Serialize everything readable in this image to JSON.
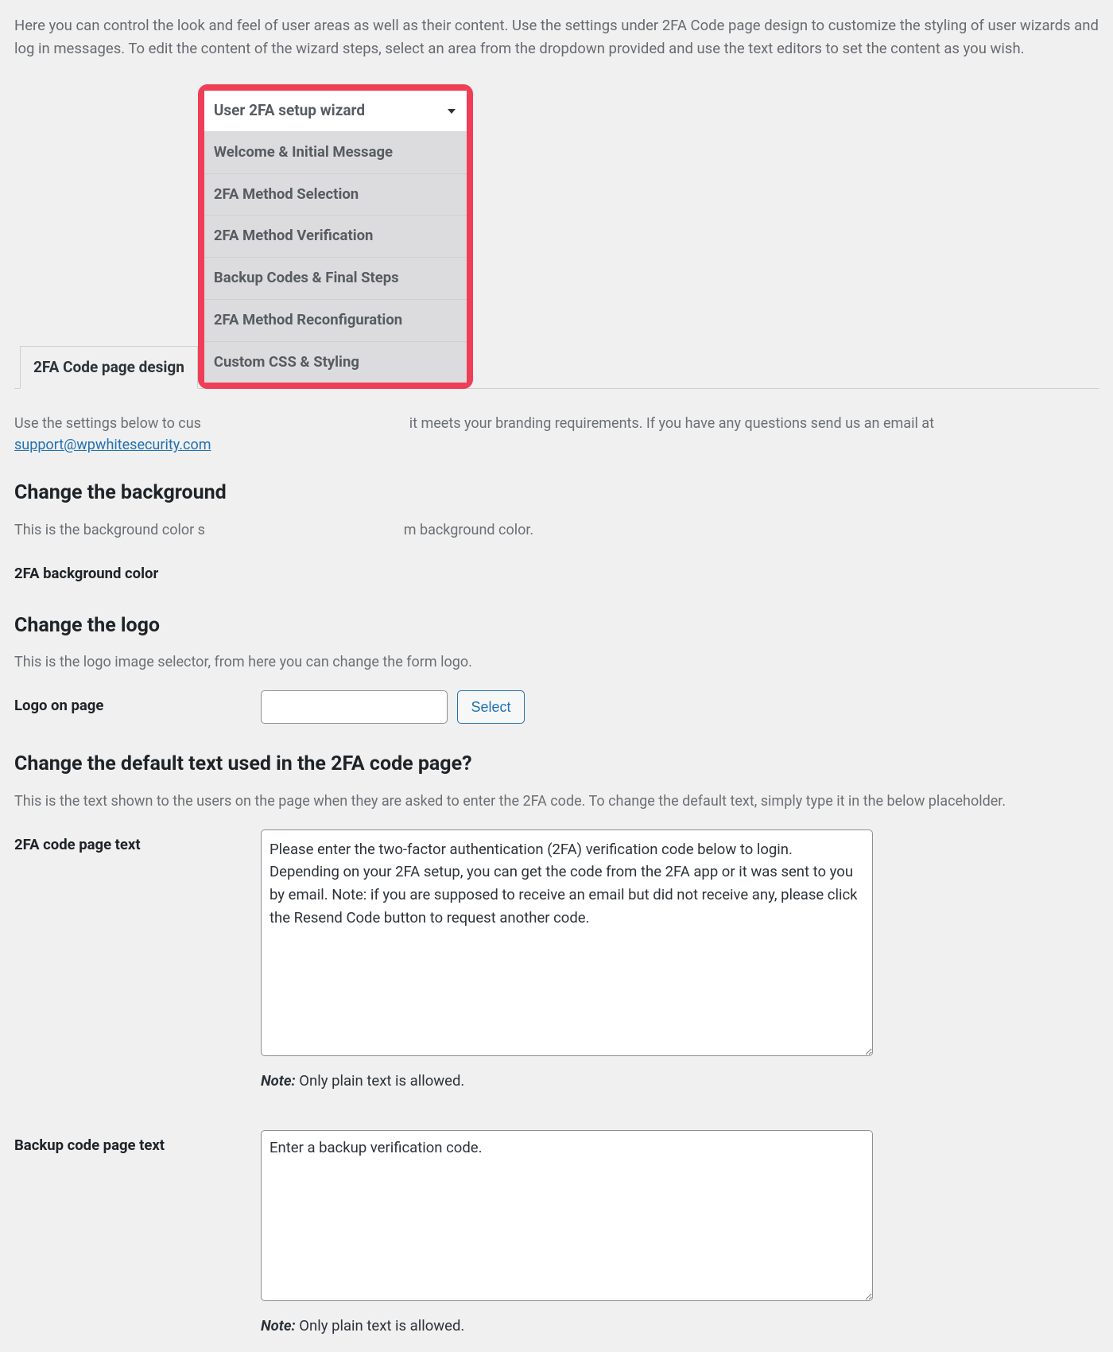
{
  "intro": "Here you can control the look and feel of user areas as well as their content. Use the settings under 2FA Code page design to customize the styling of user wizards and log in messages. To edit the content of the wizard steps, select an area from the dropdown provided and use the text editors to set the content as you wish.",
  "tabs": {
    "active_label": "2FA Code page design",
    "dropdown": {
      "selected": "User 2FA setup wizard",
      "options": [
        "Welcome & Initial Message",
        "2FA Method Selection",
        "2FA Method Verification",
        "Backup Codes & Final Steps",
        "2FA Method Reconfiguration",
        "Custom CSS & Styling"
      ]
    }
  },
  "below_tabs": {
    "desc_prefix": "Use the settings below to cus",
    "desc_suffix": " it meets your branding requirements. If you have any questions send us an email at ",
    "email": "support@wpwhitesecurity.com"
  },
  "sections": {
    "bg": {
      "heading": "Change the background",
      "desc_prefix": "This is the background color s",
      "desc_suffix": "m background color.",
      "label": "2FA background color"
    },
    "logo": {
      "heading": "Change the logo",
      "desc": "This is the logo image selector, from here you can change the form logo.",
      "label": "Logo on page",
      "button": "Select"
    },
    "text": {
      "heading": "Change the default text used in the 2FA code page?",
      "desc": "This is the text shown to the users on the page when they are asked to enter the 2FA code. To change the default text, simply type it in the below placeholder.",
      "code_label": "2FA code page text",
      "code_value": "Please enter the two-factor authentication (2FA) verification code below to login. Depending on your 2FA setup, you can get the code from the 2FA app or it was sent to you by email. Note: if you are supposed to receive an email but did not receive any, please click the Resend Code button to request another code.",
      "backup_label": "Backup code page text",
      "backup_value": "Enter a backup verification code.",
      "note_label": "Note:",
      "note_text": " Only plain text is allowed."
    }
  }
}
